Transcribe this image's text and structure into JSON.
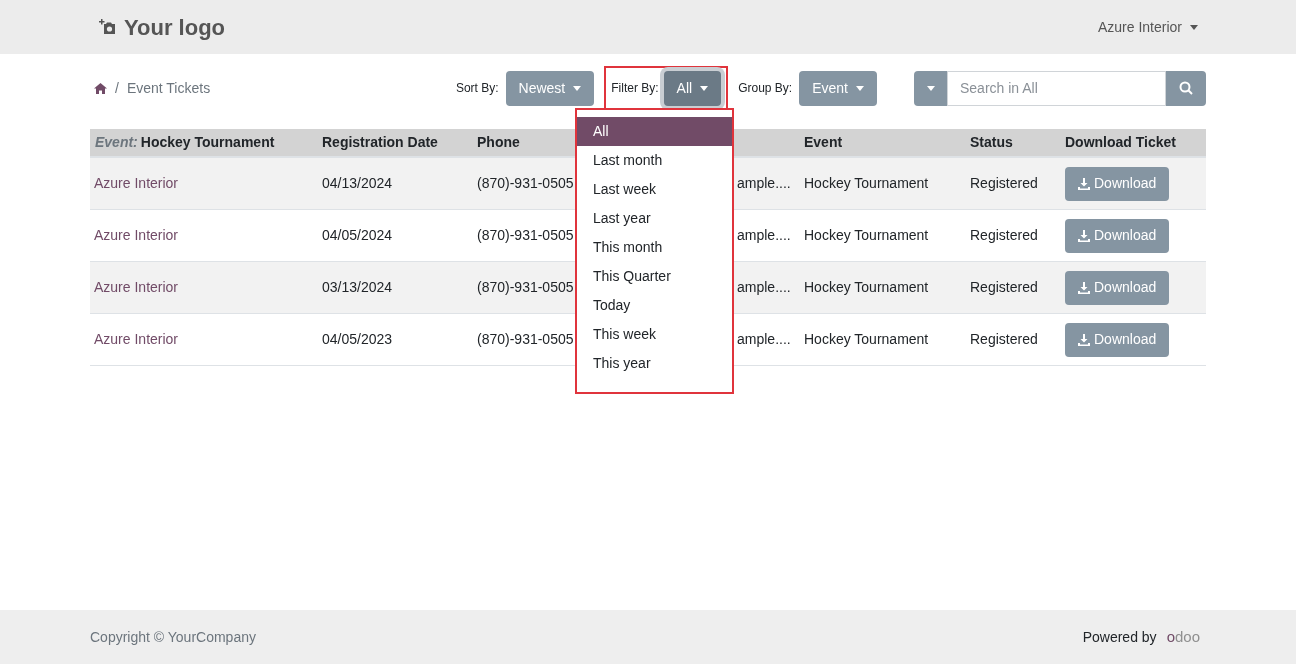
{
  "header": {
    "logo": "Your logo",
    "user_menu": "Azure Interior"
  },
  "breadcrumb": [
    {
      "separator": "/",
      "label": "Event Tickets"
    }
  ],
  "controls": {
    "sort_by": {
      "label": "Sort By:",
      "value": "Newest"
    },
    "filter_by": {
      "label": "Filter By:",
      "value": "All",
      "highlight": true,
      "expanded": true
    },
    "group_by": {
      "label": "Group By:",
      "value": "Event"
    },
    "search": {
      "placeholder": "Search in All"
    }
  },
  "filter_menu": {
    "highlight": true,
    "items": [
      {
        "label": "All",
        "selected": true
      },
      {
        "label": "Last month",
        "selected": false
      },
      {
        "label": "Last week",
        "selected": false
      },
      {
        "label": "Last year",
        "selected": false
      },
      {
        "label": "This month",
        "selected": false
      },
      {
        "label": "This Quarter",
        "selected": false
      },
      {
        "label": "Today",
        "selected": false
      },
      {
        "label": "This week",
        "selected": false
      },
      {
        "label": "This year",
        "selected": false
      }
    ]
  },
  "table": {
    "group_label": "Event:",
    "group_value": "Hockey Tournament",
    "columns": [
      "Registration Date",
      "Phone",
      "",
      "Event",
      "Status",
      "Download Ticket"
    ],
    "rows": [
      {
        "attendee": "Azure Interior",
        "date": "04/13/2024",
        "phone": "(870)-931-0505",
        "column_4": "ample....",
        "event": "Hockey Tournament",
        "status": "Registered",
        "action": "Download"
      },
      {
        "attendee": "Azure Interior",
        "date": "04/05/2024",
        "phone": "(870)-931-0505",
        "column_4": "ample....",
        "event": "Hockey Tournament",
        "status": "Registered",
        "action": "Download"
      },
      {
        "attendee": "Azure Interior",
        "date": "03/13/2024",
        "phone": "(870)-931-0505",
        "column_4": "ample....",
        "event": "Hockey Tournament",
        "status": "Registered",
        "action": "Download"
      },
      {
        "attendee": "Azure Interior",
        "date": "04/05/2023",
        "phone": "(870)-931-0505",
        "column_4": "ample....",
        "event": "Hockey Tournament",
        "status": "Registered",
        "action": "Download"
      }
    ]
  },
  "footer": {
    "copyright": "Copyright © YourCompany",
    "powered_by": "Powered by",
    "brand": "odoo"
  }
}
